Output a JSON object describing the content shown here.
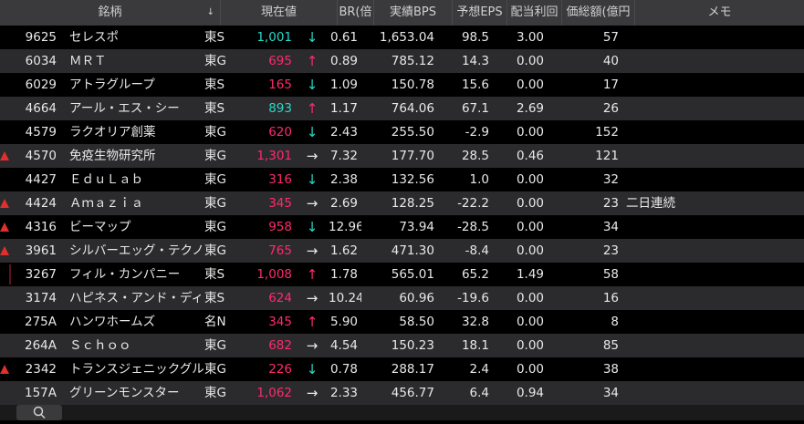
{
  "columns": {
    "name": "銘柄",
    "price": "現在値",
    "pbr": "BR(倍",
    "bps": "実績BPS",
    "eps": "予想EPS",
    "div": "配当利回",
    "cap": "価総額(億円",
    "memo": "メモ"
  },
  "rows": [
    {
      "mark": "",
      "code": "9625",
      "name": "セレスポ",
      "market": "東S",
      "price": "1,001",
      "pcolor": "cyan",
      "arrow": "↓",
      "pbr": "0.61",
      "bps": "1,653.04",
      "eps": "98.5",
      "div": "3.00",
      "cap": "57",
      "memo": ""
    },
    {
      "mark": "",
      "code": "6034",
      "name": "ＭＲＴ",
      "market": "東G",
      "price": "695",
      "pcolor": "red",
      "arrow": "↑",
      "pbr": "0.89",
      "bps": "785.12",
      "eps": "14.3",
      "div": "0.00",
      "cap": "40",
      "memo": ""
    },
    {
      "mark": "",
      "code": "6029",
      "name": "アトラグループ",
      "market": "東S",
      "price": "165",
      "pcolor": "red",
      "arrow": "↓",
      "pbr": "1.09",
      "bps": "150.78",
      "eps": "15.6",
      "div": "0.00",
      "cap": "17",
      "memo": ""
    },
    {
      "mark": "",
      "code": "4664",
      "name": "アール・エス・シー",
      "market": "東S",
      "price": "893",
      "pcolor": "cyan",
      "arrow": "↑",
      "pbr": "1.17",
      "bps": "764.06",
      "eps": "67.1",
      "div": "2.69",
      "cap": "26",
      "memo": ""
    },
    {
      "mark": "",
      "code": "4579",
      "name": "ラクオリア創薬",
      "market": "東G",
      "price": "620",
      "pcolor": "red",
      "arrow": "↓",
      "pbr": "2.43",
      "bps": "255.50",
      "eps": "-2.9",
      "div": "0.00",
      "cap": "152",
      "memo": ""
    },
    {
      "mark": "tri",
      "code": "4570",
      "name": "免疫生物研究所",
      "market": "東G",
      "price": "1,301",
      "pcolor": "red",
      "arrow": "→",
      "pbr": "7.32",
      "bps": "177.70",
      "eps": "28.5",
      "div": "0.46",
      "cap": "121",
      "memo": ""
    },
    {
      "mark": "",
      "code": "4427",
      "name": "ＥｄｕＬａｂ",
      "market": "東G",
      "price": "316",
      "pcolor": "red",
      "arrow": "↓",
      "pbr": "2.38",
      "bps": "132.56",
      "eps": "1.0",
      "div": "0.00",
      "cap": "32",
      "memo": ""
    },
    {
      "mark": "tri",
      "code": "4424",
      "name": "Ａｍａｚｉａ",
      "market": "東G",
      "price": "345",
      "pcolor": "red",
      "arrow": "→",
      "pbr": "2.69",
      "bps": "128.25",
      "eps": "-22.2",
      "div": "0.00",
      "cap": "23",
      "memo": "二日連続"
    },
    {
      "mark": "tri",
      "code": "4316",
      "name": "ビーマップ",
      "market": "東G",
      "price": "958",
      "pcolor": "red",
      "arrow": "↓",
      "pbr": "12.96",
      "bps": "73.94",
      "eps": "-28.5",
      "div": "0.00",
      "cap": "34",
      "memo": ""
    },
    {
      "mark": "tri",
      "code": "3961",
      "name": "シルバーエッグ・テクノロ...",
      "market": "東G",
      "price": "765",
      "pcolor": "red",
      "arrow": "→",
      "pbr": "1.62",
      "bps": "471.30",
      "eps": "-8.4",
      "div": "0.00",
      "cap": "23",
      "memo": ""
    },
    {
      "mark": "bar",
      "code": "3267",
      "name": "フィル・カンパニー",
      "market": "東S",
      "price": "1,008",
      "pcolor": "red",
      "arrow": "↑",
      "pbr": "1.78",
      "bps": "565.01",
      "eps": "65.2",
      "div": "1.49",
      "cap": "58",
      "memo": ""
    },
    {
      "mark": "",
      "code": "3174",
      "name": "ハピネス・アンド・ディ",
      "market": "東S",
      "price": "624",
      "pcolor": "red",
      "arrow": "→",
      "pbr": "10.24",
      "bps": "60.96",
      "eps": "-19.6",
      "div": "0.00",
      "cap": "16",
      "memo": ""
    },
    {
      "mark": "",
      "code": "275A",
      "name": "ハンワホームズ",
      "market": "名N",
      "price": "345",
      "pcolor": "red",
      "arrow": "↑",
      "pbr": "5.90",
      "bps": "58.50",
      "eps": "32.8",
      "div": "0.00",
      "cap": "8",
      "memo": ""
    },
    {
      "mark": "",
      "code": "264A",
      "name": "Ｓｃｈｏｏ",
      "market": "東G",
      "price": "682",
      "pcolor": "red",
      "arrow": "→",
      "pbr": "4.54",
      "bps": "150.23",
      "eps": "18.1",
      "div": "0.00",
      "cap": "85",
      "memo": ""
    },
    {
      "mark": "tri",
      "code": "2342",
      "name": "トランスジェニックグループ",
      "market": "東G",
      "price": "226",
      "pcolor": "red",
      "arrow": "↓",
      "pbr": "0.78",
      "bps": "288.17",
      "eps": "2.4",
      "div": "0.00",
      "cap": "38",
      "memo": ""
    },
    {
      "mark": "",
      "code": "157A",
      "name": "グリーンモンスター",
      "market": "東G",
      "price": "1,062",
      "pcolor": "red",
      "arrow": "→",
      "pbr": "2.33",
      "bps": "456.77",
      "eps": "6.4",
      "div": "0.94",
      "cap": "34",
      "memo": ""
    }
  ],
  "icons": {
    "search": "search-icon",
    "sort": "sort-icon"
  }
}
